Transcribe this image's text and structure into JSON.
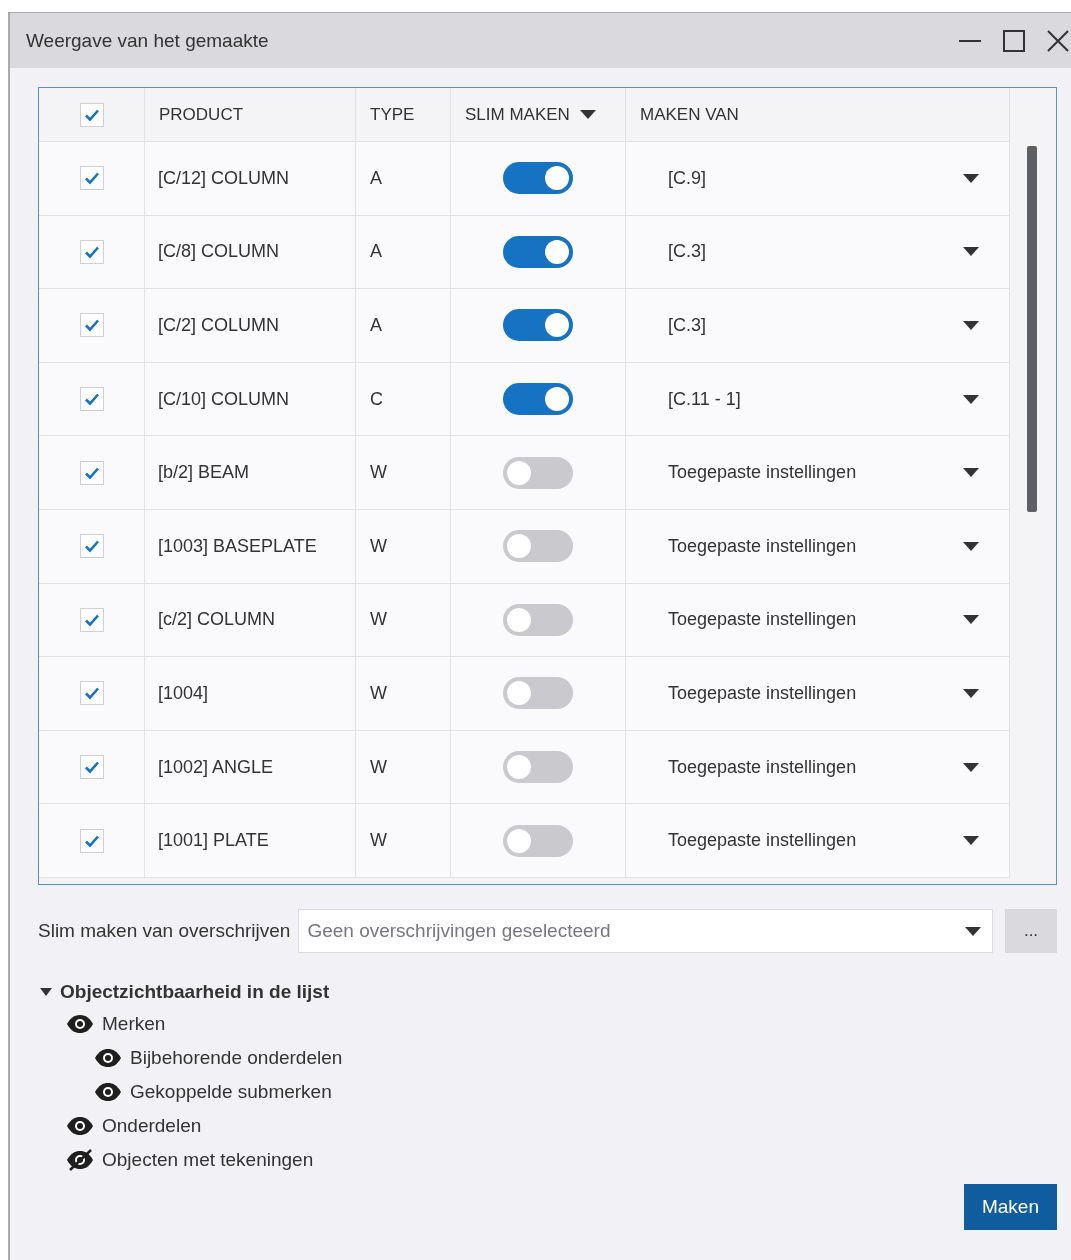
{
  "window": {
    "title": "Weergave van het gemaakte"
  },
  "table": {
    "select_all_checked": true,
    "columns": [
      {
        "label": "PRODUCT",
        "sort_caret": false
      },
      {
        "label": "TYPE",
        "sort_caret": false
      },
      {
        "label": "SLIM MAKEN",
        "sort_caret": true
      },
      {
        "label": "MAKEN VAN",
        "sort_caret": false
      }
    ],
    "rows": [
      {
        "checked": true,
        "product": "[C/12] COLUMN",
        "type": "A",
        "slim_maken": true,
        "maken_van": "[C.9]"
      },
      {
        "checked": true,
        "product": "[C/8] COLUMN",
        "type": "A",
        "slim_maken": true,
        "maken_van": "[C.3]"
      },
      {
        "checked": true,
        "product": "[C/2] COLUMN",
        "type": "A",
        "slim_maken": true,
        "maken_van": "[C.3]"
      },
      {
        "checked": true,
        "product": "[C/10] COLUMN",
        "type": "C",
        "slim_maken": true,
        "maken_van": "[C.11 - 1]"
      },
      {
        "checked": true,
        "product": "[b/2] BEAM",
        "type": "W",
        "slim_maken": false,
        "maken_van": "Toegepaste instellingen"
      },
      {
        "checked": true,
        "product": "[1003] BASEPLATE",
        "type": "W",
        "slim_maken": false,
        "maken_van": "Toegepaste instellingen"
      },
      {
        "checked": true,
        "product": "[c/2] COLUMN",
        "type": "W",
        "slim_maken": false,
        "maken_van": "Toegepaste instellingen"
      },
      {
        "checked": true,
        "product": "[1004]",
        "type": "W",
        "slim_maken": false,
        "maken_van": "Toegepaste instellingen"
      },
      {
        "checked": true,
        "product": "[1002] ANGLE",
        "type": "W",
        "slim_maken": false,
        "maken_van": "Toegepaste instellingen"
      },
      {
        "checked": true,
        "product": "[1001] PLATE",
        "type": "W",
        "slim_maken": false,
        "maken_van": "Toegepaste instellingen"
      }
    ]
  },
  "override": {
    "label": "Slim maken van overschrijven",
    "placeholder": "Geen overschrijvingen geselecteerd",
    "browse_button": "..."
  },
  "visibility": {
    "title": "Objectzichtbaarheid in de lijst",
    "expanded": true,
    "items": [
      {
        "label": "Merken",
        "visible": true,
        "children": [
          {
            "label": "Bijbehorende onderdelen",
            "visible": true
          },
          {
            "label": "Gekoppelde submerken",
            "visible": true
          }
        ]
      },
      {
        "label": "Onderdelen",
        "visible": true
      },
      {
        "label": "Objecten met tekeningen",
        "visible": false
      }
    ]
  },
  "buttons": [
    {
      "label": "Maken"
    }
  ]
}
